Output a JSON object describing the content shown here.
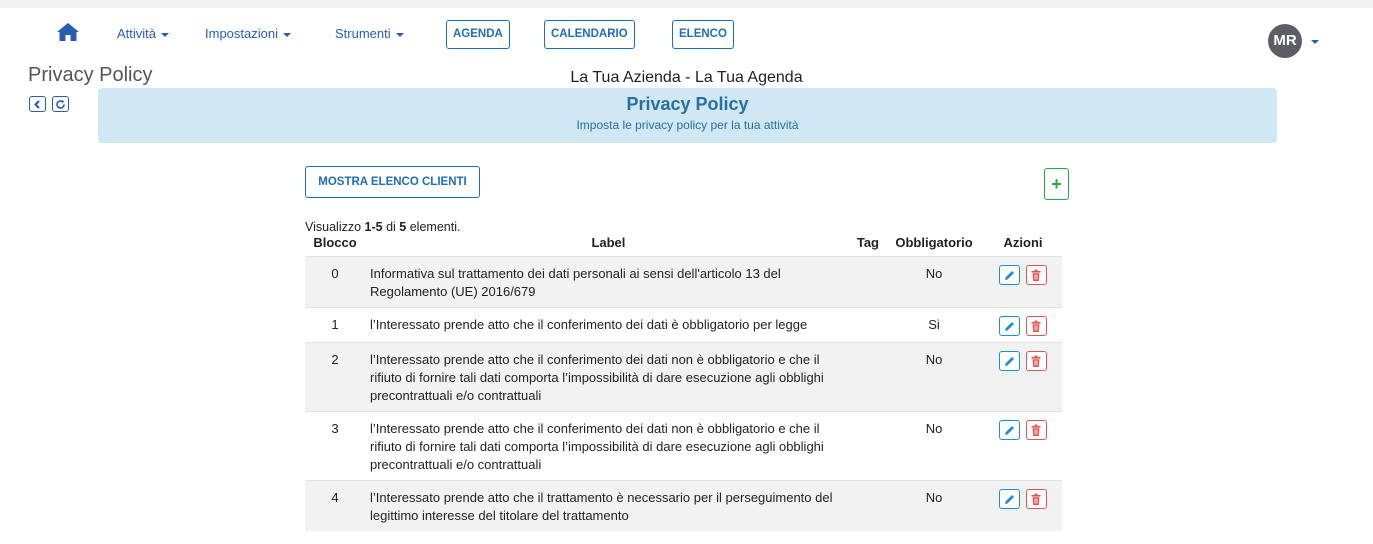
{
  "nav": {
    "menus": [
      {
        "label": "Attività"
      },
      {
        "label": "Impostazioni"
      },
      {
        "label": "Strumenti"
      }
    ],
    "buttons": [
      {
        "label": "AGENDA"
      },
      {
        "label": "CALENDARIO"
      },
      {
        "label": "ELENCO"
      }
    ],
    "avatar_initials": "MR"
  },
  "page": {
    "title": "Privacy Policy",
    "company": "La Tua Azienda - La Tua Agenda"
  },
  "banner": {
    "title": "Privacy Policy",
    "subtitle": "Imposta le privacy policy per la tua attività"
  },
  "toolbar": {
    "show_clients_label": "MOSTRA ELENCO CLIENTI",
    "add_label": "+"
  },
  "summary": {
    "prefix": "Visualizzo ",
    "range": "1-5",
    "middle": " di ",
    "total": "5",
    "suffix": " elementi."
  },
  "table": {
    "headers": {
      "blocco": "Blocco",
      "label": "Label",
      "tag": "Tag",
      "obbligatorio": "Obbligatorio",
      "azioni": "Azioni"
    },
    "rows": [
      {
        "blocco": "0",
        "label": "Informativa sul trattamento dei dati personali ai sensi dell'articolo 13 del Regolamento (UE) 2016/679",
        "tag": "",
        "obbligatorio": "No"
      },
      {
        "blocco": "1",
        "label": "l’Interessato prende atto che il conferimento dei dati è obbligatorio per legge",
        "tag": "",
        "obbligatorio": "Si"
      },
      {
        "blocco": "2",
        "label": "l’Interessato prende atto che il conferimento dei dati non è obbligatorio e che il rifiuto di fornire tali dati comporta l’impossibilità di dare esecuzione agli obblighi precontrattuali e/o contrattuali",
        "tag": "",
        "obbligatorio": "No"
      },
      {
        "blocco": "3",
        "label": "l’Interessato prende atto che il conferimento dei dati non è obbligatorio e che il rifiuto di fornire tali dati comporta l’impossibilità di dare esecuzione agli obblighi precontrattuali e/o contrattuali",
        "tag": "",
        "obbligatorio": "No"
      },
      {
        "blocco": "4",
        "label": "l’Interessato prende atto che il trattamento è necessario per il perseguimento del legittimo interesse del titolare del trattamento",
        "tag": "",
        "obbligatorio": "No"
      }
    ]
  },
  "icons": {
    "home": "home-icon",
    "back": "chevron-left-icon",
    "refresh": "refresh-icon",
    "edit": "pencil-icon",
    "delete": "trash-icon"
  },
  "colors": {
    "link": "#2a5db0",
    "primary": "#1f6fb2",
    "banner_bg": "#d0e8f3",
    "banner_text": "#2a6f9e",
    "success": "#28a745",
    "danger": "#e05555"
  }
}
